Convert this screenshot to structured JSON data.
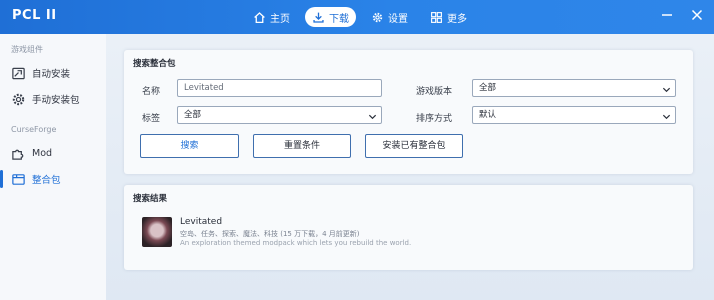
{
  "app": {
    "title": "PCL II"
  },
  "nav": {
    "items": [
      {
        "label": "主页",
        "icon": "home-icon",
        "active": false
      },
      {
        "label": "下载",
        "icon": "download-icon",
        "active": true
      },
      {
        "label": "设置",
        "icon": "gear-icon",
        "active": false
      },
      {
        "label": "更多",
        "icon": "grid-icon",
        "active": false
      }
    ]
  },
  "window": {
    "minimize_icon": "minimize-icon",
    "close_icon": "close-icon"
  },
  "sidebar": {
    "section_game": "游戏组件",
    "auto_install": "自动安装",
    "manual_install": "手动安装包",
    "section_curseforge": "CurseForge",
    "mod": "Mod",
    "modpack": "整合包"
  },
  "search": {
    "title": "搜索整合包",
    "name_label": "名称",
    "name_value": "Levitated",
    "version_label": "游戏版本",
    "version_value": "全部",
    "tag_label": "标签",
    "tag_value": "全部",
    "sort_label": "排序方式",
    "sort_value": "默认",
    "search_button": "搜索",
    "reset_button": "重置条件",
    "install_existing_button": "安装已有整合包"
  },
  "results": {
    "title": "搜索结果",
    "items": [
      {
        "name": "Levitated",
        "tags": "空岛、任务、探索、魔法、科技 (15 万下载，4 月前更新)",
        "description": "An exploration themed modpack which lets you rebuild the world."
      }
    ]
  },
  "colors": {
    "accent": "#1f6fd6",
    "titlebar": "#2a83e8"
  }
}
